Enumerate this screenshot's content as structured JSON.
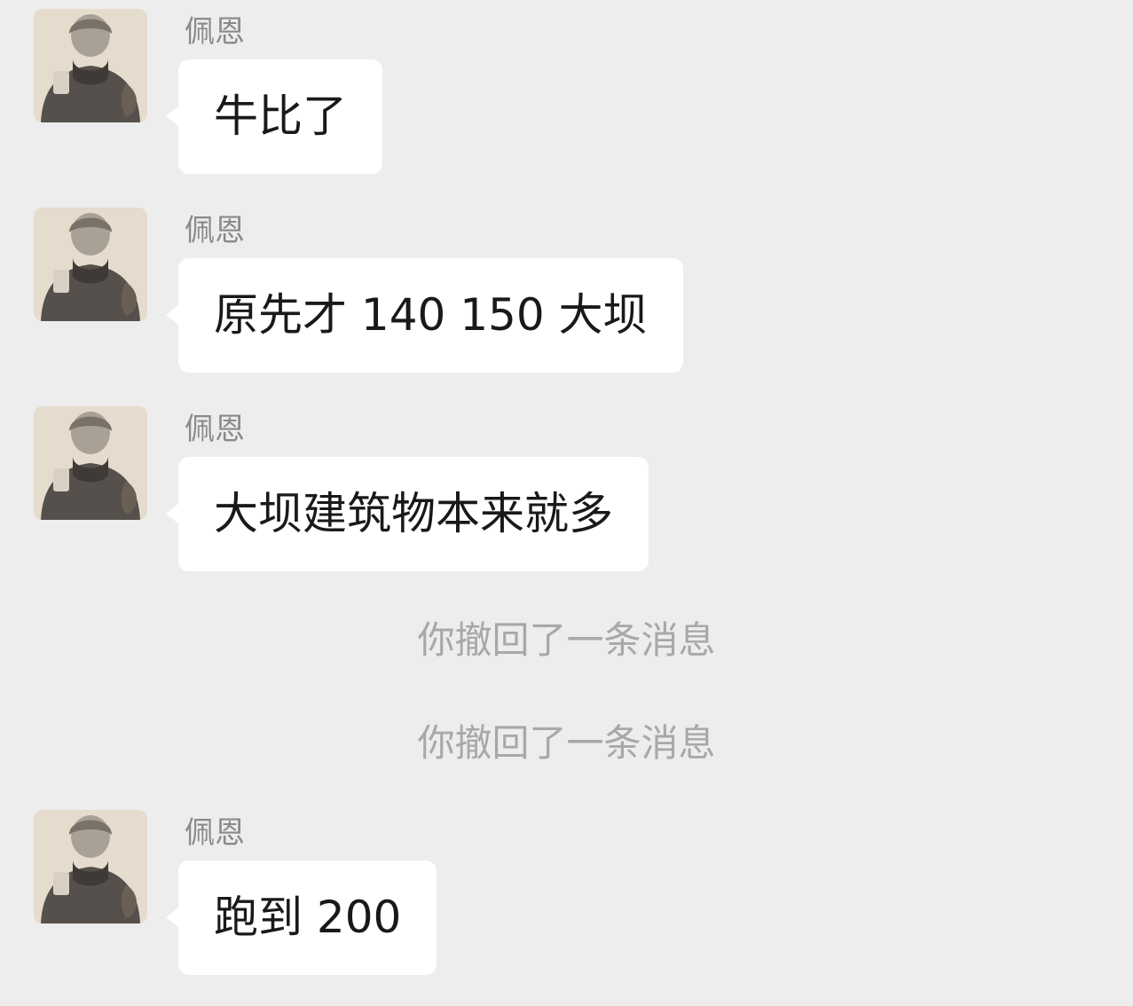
{
  "messages": [
    {
      "sender": "佩恩",
      "text": "牛比了"
    },
    {
      "sender": "佩恩",
      "text": "原先才 140 150 大坝"
    },
    {
      "sender": "佩恩",
      "text": "大坝建筑物本来就多"
    },
    {
      "system": "你撤回了一条消息"
    },
    {
      "system": "你撤回了一条消息"
    },
    {
      "sender": "佩恩",
      "text": "跑到 200"
    }
  ]
}
